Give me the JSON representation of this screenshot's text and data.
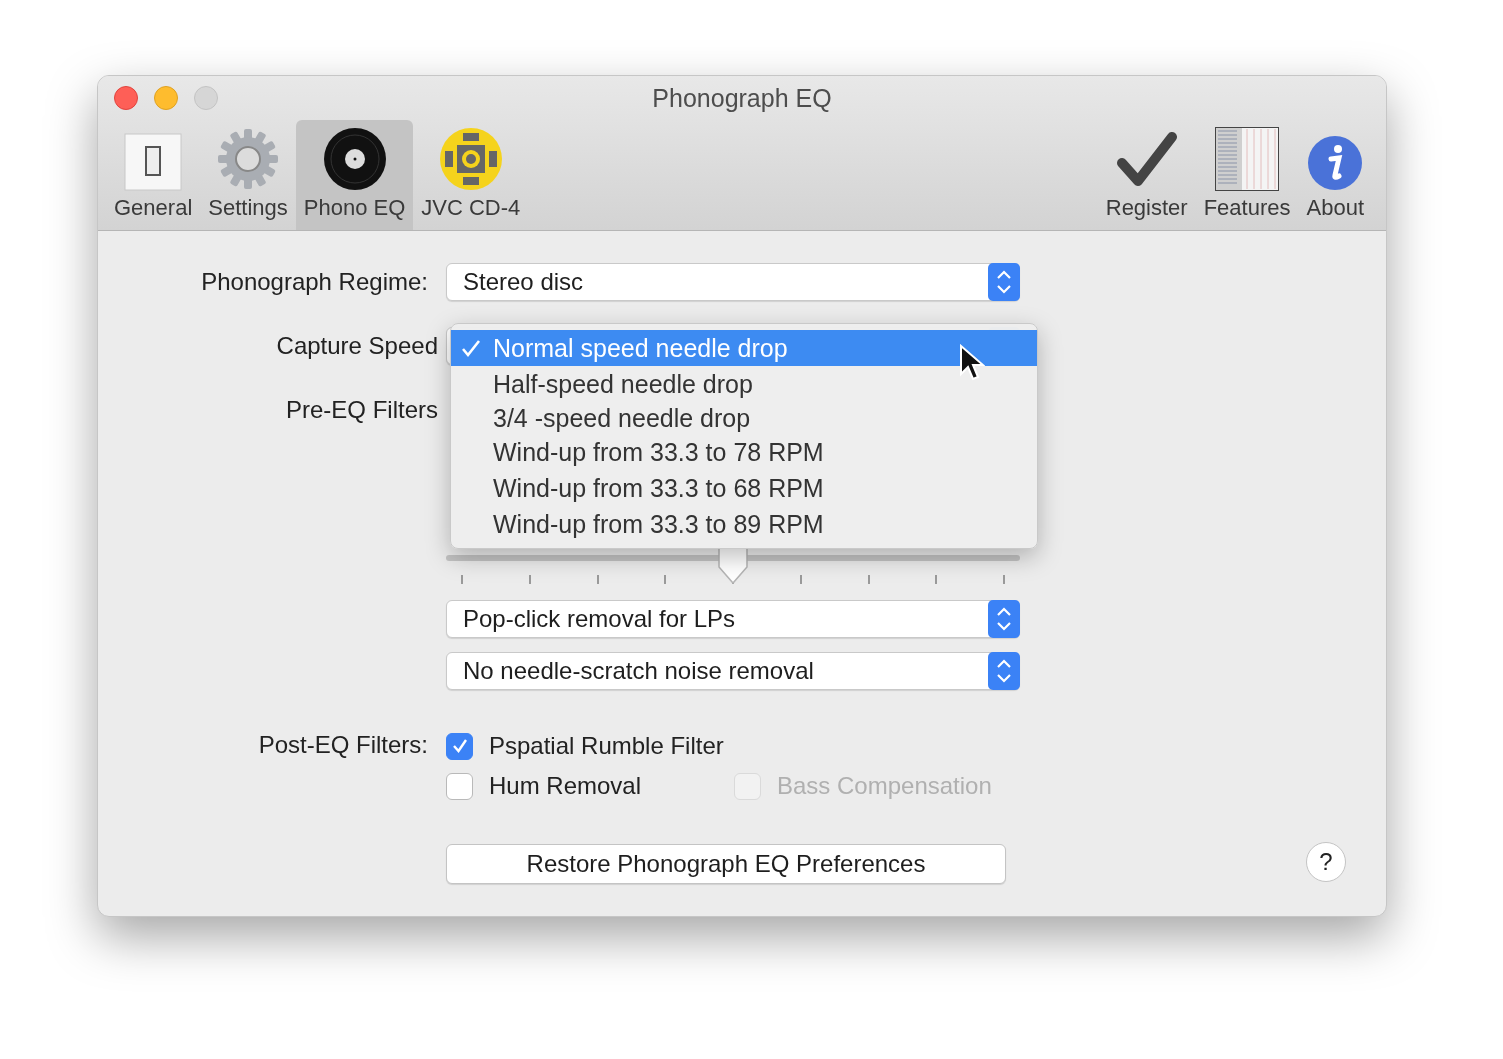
{
  "window": {
    "title": "Phonograph EQ",
    "traffic_lights": [
      {
        "kind": "close"
      },
      {
        "kind": "minimize"
      },
      {
        "kind": "zoom"
      }
    ]
  },
  "toolbar": {
    "left": [
      {
        "label": "General",
        "selected": false
      },
      {
        "label": "Settings",
        "selected": false
      },
      {
        "label": "Phono EQ",
        "selected": true
      },
      {
        "label": "JVC CD-4",
        "selected": false
      }
    ],
    "right": [
      {
        "label": "Register",
        "selected": false
      },
      {
        "label": "Features",
        "selected": false
      },
      {
        "label": "About",
        "selected": false
      }
    ]
  },
  "form": {
    "regime": {
      "label": "Phonograph Regime:",
      "value": "Stereo disc"
    },
    "capture_speed": {
      "label": "Capture Speed"
    },
    "pre_eq": {
      "label": "Pre-EQ Filters",
      "slider": {
        "level": 0.5
      },
      "popups": [
        "Pop-click removal for LPs",
        "No needle-scratch noise removal"
      ]
    },
    "post_eq": {
      "label": "Post-EQ Filters:",
      "rows": [
        [
          {
            "label": "Pspatial Rumble Filter",
            "checked": true,
            "disabled": false
          }
        ],
        [
          {
            "label": "Hum Removal",
            "checked": false,
            "disabled": false
          },
          {
            "label": "Bass Compensation",
            "checked": false,
            "disabled": true
          }
        ]
      ]
    },
    "restore_button": "Restore Phonograph EQ Preferences",
    "help_button": "?"
  },
  "menu": {
    "items": [
      {
        "label": "Normal speed needle drop",
        "selected": true
      },
      {
        "label": "Half-speed needle drop",
        "selected": false
      },
      {
        "label": "3/4 -speed needle drop",
        "selected": false
      },
      {
        "label": "Wind-up from 33.3 to 78 RPM",
        "selected": false
      },
      {
        "label": "Wind-up from 33.3 to 68 RPM",
        "selected": false
      },
      {
        "label": "Wind-up from 33.3 to 89 RPM",
        "selected": false
      }
    ]
  }
}
